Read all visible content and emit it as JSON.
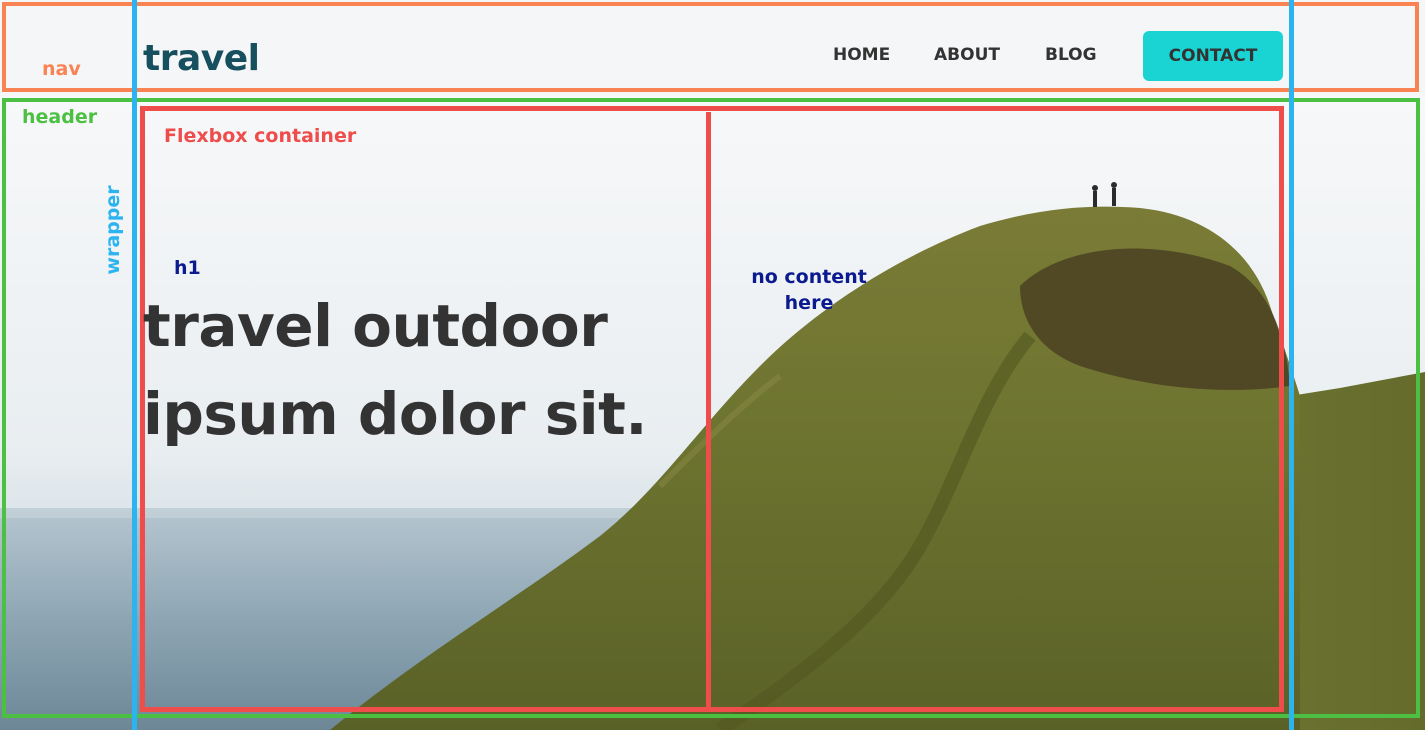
{
  "nav": {
    "brand": "travel",
    "links": [
      "HOME",
      "ABOUT",
      "BLOG"
    ],
    "contact_label": "CONTACT"
  },
  "hero": {
    "headline": "travel outdoor ipsum dolor sit."
  },
  "annotations": {
    "nav": "nav",
    "header": "header",
    "flexbox": "Flexbox container",
    "wrapper": "wrapper",
    "h1": "h1",
    "no_content": "no content here"
  },
  "colors": {
    "nav_outline": "#f98353",
    "header_outline": "#4cc043",
    "flexbox_outline": "#ef4c4c",
    "wrapper_outline": "#2bb4ef",
    "annotation_text": "#0b1a8e",
    "brand": "#16505e",
    "contact_button": "#19d4d3",
    "text": "#333333"
  }
}
